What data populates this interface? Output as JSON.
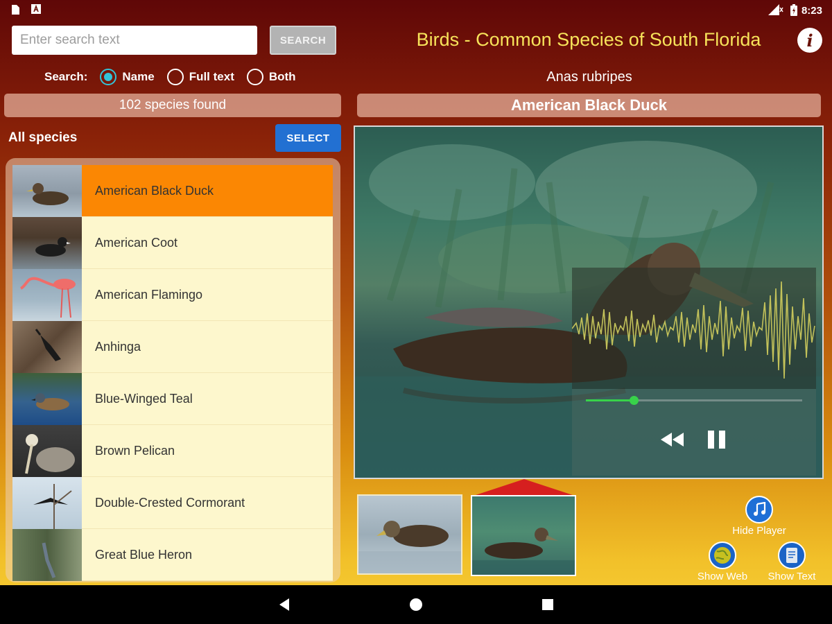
{
  "status_bar": {
    "time": "8:23"
  },
  "search": {
    "placeholder": "Enter search text",
    "value": "",
    "button_label": "SEARCH"
  },
  "app": {
    "title": "Birds - Common Species of South Florida"
  },
  "search_mode": {
    "label": "Search:",
    "options": [
      {
        "label": "Name",
        "checked": true
      },
      {
        "label": "Full text",
        "checked": false
      },
      {
        "label": "Both",
        "checked": false
      }
    ]
  },
  "results": {
    "count_text": "102 species found"
  },
  "list": {
    "header": "All species",
    "select_label": "SELECT",
    "items": [
      {
        "label": "American Black Duck",
        "selected": true
      },
      {
        "label": "American Coot",
        "selected": false
      },
      {
        "label": "American Flamingo",
        "selected": false
      },
      {
        "label": "Anhinga",
        "selected": false
      },
      {
        "label": "Blue-Winged Teal",
        "selected": false
      },
      {
        "label": "Brown Pelican",
        "selected": false
      },
      {
        "label": "Double-Crested Cormorant",
        "selected": false
      },
      {
        "label": "Great Blue Heron",
        "selected": false
      }
    ]
  },
  "detail": {
    "latin_name": "Anas rubripes",
    "common_name": "American Black Duck",
    "audio": {
      "progress": 0.22,
      "state": "playing"
    },
    "photos": {
      "count": 2,
      "selected_index": 1
    }
  },
  "actions": {
    "hide_player": "Hide Player",
    "show_web": "Show Web",
    "show_text": "Show Text"
  },
  "colors": {
    "selected_item": "#fb8703",
    "list_item": "#fdf7cd",
    "title_text": "#f7e35a",
    "accent_radio": "#33c3d8",
    "select_button": "#2270d2",
    "progress": "#38d24a"
  }
}
